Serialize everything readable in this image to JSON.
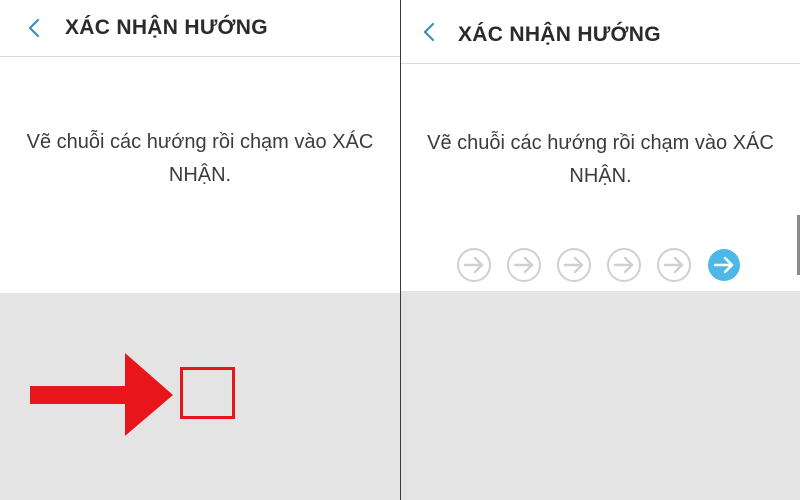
{
  "left_screen": {
    "header": {
      "back_icon": "chevron-left-icon",
      "title": "XÁC NHẬN HƯỚNG"
    },
    "instruction": "Vẽ chuỗi các hướng rồi chạm vào XÁC NHẬN.",
    "annotation": {
      "arrow_color": "#e8161b",
      "box_color": "#e8161b"
    }
  },
  "right_screen": {
    "header": {
      "back_icon": "chevron-left-icon",
      "title": "XÁC NHẬN HƯỚNG"
    },
    "instruction": "Vẽ chuỗi các hướng rồi chạm vào XÁC NHẬN.",
    "direction_sequence": [
      {
        "direction": "right",
        "state": "inactive"
      },
      {
        "direction": "right",
        "state": "inactive"
      },
      {
        "direction": "right",
        "state": "inactive"
      },
      {
        "direction": "right",
        "state": "inactive"
      },
      {
        "direction": "right",
        "state": "inactive"
      },
      {
        "direction": "right",
        "state": "active"
      }
    ]
  },
  "colors": {
    "accent": "#4db8e8",
    "back_icon": "#3a8fb7",
    "inactive_arrow": "#d0d0d0",
    "input_area": "#e4e4e4"
  }
}
